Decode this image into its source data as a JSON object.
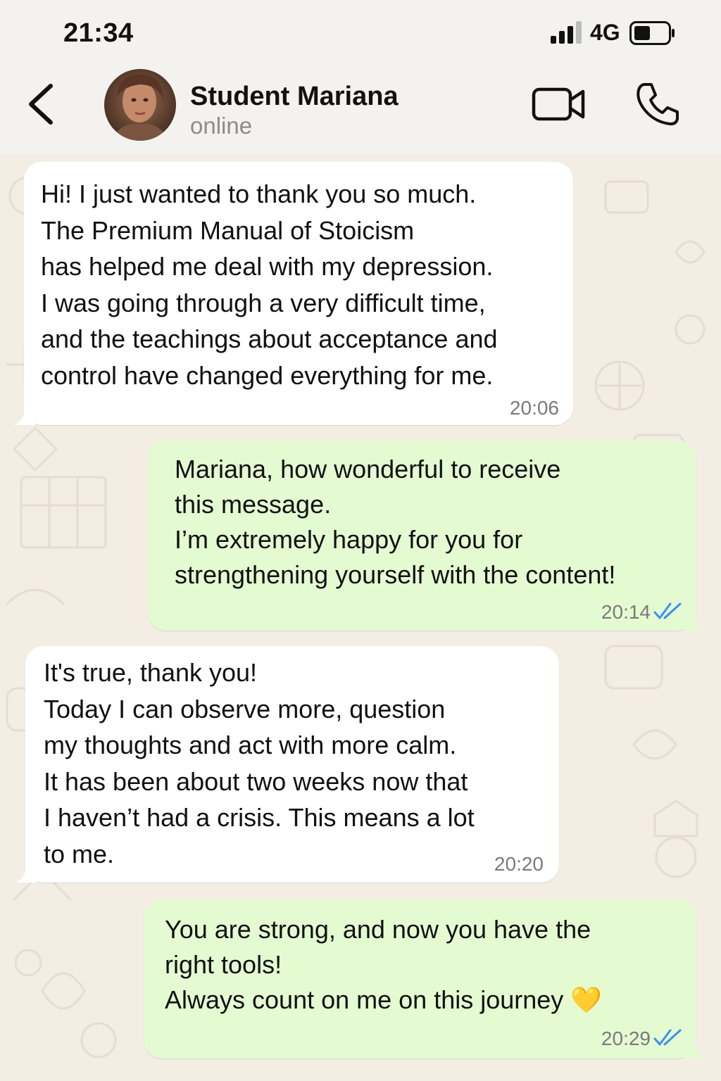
{
  "status_bar": {
    "time": "21:34",
    "network": "4G"
  },
  "header": {
    "contact_name": "Student Mariana",
    "contact_status": "online"
  },
  "messages": [
    {
      "direction": "incoming",
      "text": "Hi! I just wanted to thank you so much.\nThe Premium Manual of Stoicism\nhas helped me deal with my depression.\nI was going through a very difficult time,\nand the teachings about acceptance and\ncontrol have changed everything for me.",
      "time": "20:06"
    },
    {
      "direction": "outgoing",
      "text": "Mariana, how wonderful to receive\nthis message.\nI’m extremely happy for you for\nstrengthening yourself with the content!",
      "time": "20:14",
      "status": "read"
    },
    {
      "direction": "incoming",
      "text": "It's true, thank you!\nToday I can observe more, question\nmy thoughts and act with more calm.\nIt has been about two weeks now that\nI haven’t had a crisis. This means a lot\nto me.",
      "time": "20:20"
    },
    {
      "direction": "outgoing",
      "text": "You are strong, and now you have the\nright tools!\nAlways count on me on this journey 💛",
      "time": "20:29",
      "status": "read"
    }
  ],
  "colors": {
    "outgoing_bubble": "#e4fbd2",
    "incoming_bubble": "#ffffff",
    "read_ticks": "#3b8ff0",
    "chat_background": "#f3ede4"
  },
  "icons": {
    "back": "chevron-left-icon",
    "video": "video-camera-icon",
    "call": "phone-icon",
    "signal": "signal-bars-icon",
    "battery": "battery-icon",
    "read": "double-check-icon"
  }
}
